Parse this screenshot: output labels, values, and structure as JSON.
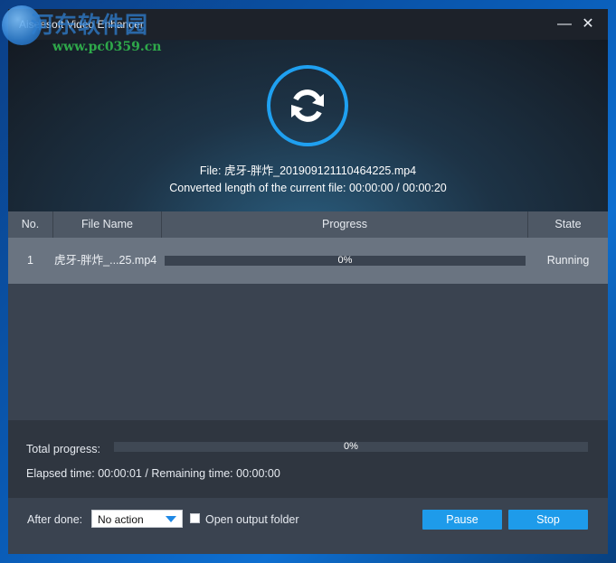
{
  "window": {
    "title": "Aiseesoft Video Enhancer"
  },
  "header": {
    "file_label": "File:",
    "file_name": "虎牙-胖炸_201909121110464225.mp4",
    "converted_label": "Converted length of the current file:",
    "converted_value": "00:00:00 / 00:00:20"
  },
  "watermark": {
    "site_name": "河东软件园",
    "url": "www.pc0359.cn"
  },
  "table": {
    "columns": [
      "No.",
      "File Name",
      "Progress",
      "State"
    ],
    "rows": [
      {
        "no": "1",
        "file_name": "虎牙-胖炸_...25.mp4",
        "progress_text": "0%",
        "progress_value": 0,
        "state": "Running"
      }
    ]
  },
  "status": {
    "total_progress_label": "Total progress:",
    "total_progress_text": "0%",
    "total_progress_value": 0,
    "elapsed_label": "Elapsed time:",
    "elapsed_value": "00:00:01",
    "remaining_label": "Remaining time:",
    "remaining_value": "00:00:00"
  },
  "footer": {
    "after_done_label": "After done:",
    "after_done_value": "No action",
    "open_folder_label": "Open output folder",
    "open_folder_checked": false,
    "pause_label": "Pause",
    "stop_label": "Stop"
  },
  "colors": {
    "accent": "#1e9bea",
    "sync_ring": "#1fa0f0"
  },
  "icons": {
    "header": "sync-icon",
    "minimize": "minimize-icon",
    "close": "close-icon",
    "dropdown": "chevron-down-icon"
  }
}
